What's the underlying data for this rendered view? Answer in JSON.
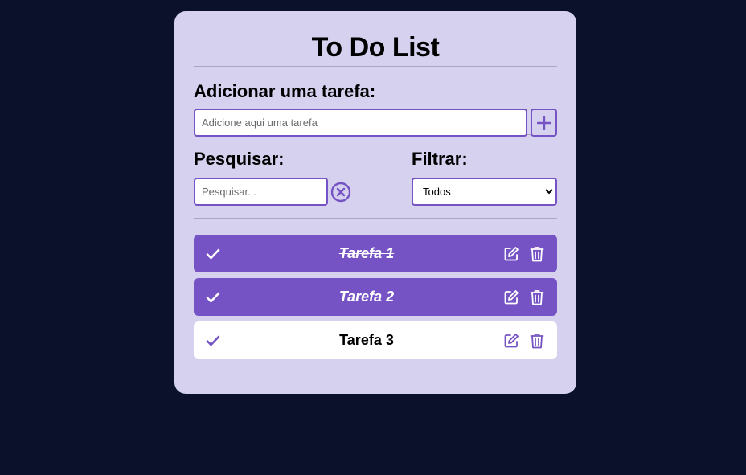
{
  "app": {
    "title": "To Do List"
  },
  "add": {
    "label": "Adicionar uma tarefa:",
    "placeholder": "Adicione aqui uma tarefa",
    "button_icon": "plus-icon"
  },
  "search": {
    "label": "Pesquisar:",
    "placeholder": "Pesquisar...",
    "clear_icon": "circle-x-icon"
  },
  "filter": {
    "label": "Filtrar:",
    "selected": "Todos"
  },
  "todos": [
    {
      "text": "Tarefa 1",
      "done": true
    },
    {
      "text": "Tarefa 2",
      "done": true
    },
    {
      "text": "Tarefa 3",
      "done": false
    }
  ],
  "colors": {
    "background": "#0b112b",
    "card": "#d5d1ef",
    "accent": "#7553c4",
    "item_default": "#ffffff"
  },
  "icons": {
    "check": "check-icon",
    "edit": "edit-icon",
    "delete": "trash-icon"
  }
}
